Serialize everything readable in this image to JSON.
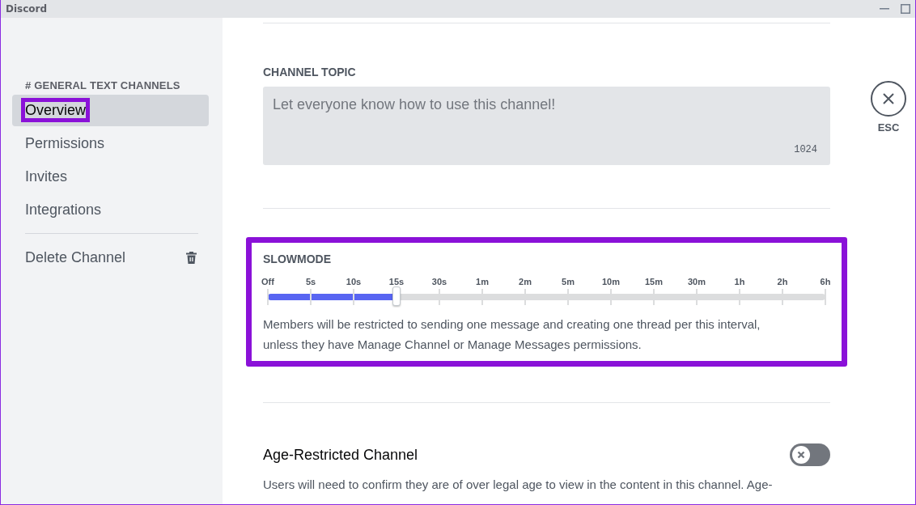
{
  "window": {
    "title": "Discord"
  },
  "sidebar": {
    "header": "# **GENERAL** TEXT CHANNELS",
    "items": [
      {
        "label": "Overview",
        "selected": true
      },
      {
        "label": "Permissions",
        "selected": false
      },
      {
        "label": "Invites",
        "selected": false
      },
      {
        "label": "Integrations",
        "selected": false
      }
    ],
    "delete_label": "Delete Channel"
  },
  "channel_topic": {
    "label": "CHANNEL TOPIC",
    "placeholder": "Let everyone know how to use this channel!",
    "counter": "1024"
  },
  "slowmode": {
    "label": "SLOWMODE",
    "ticks": [
      "Off",
      "5s",
      "10s",
      "15s",
      "30s",
      "1m",
      "2m",
      "5m",
      "10m",
      "15m",
      "30m",
      "1h",
      "2h",
      "6h"
    ],
    "level": 0.2308,
    "description": "Members will be restricted to sending one message and creating one thread per this interval, unless they have Manage Channel or Manage Messages permissions."
  },
  "age_restricted": {
    "label": "Age-Restricted Channel",
    "on": false,
    "description": "Users will need to confirm they are of over legal age to view in the content in this channel. Age-"
  },
  "close": {
    "label": "ESC"
  }
}
